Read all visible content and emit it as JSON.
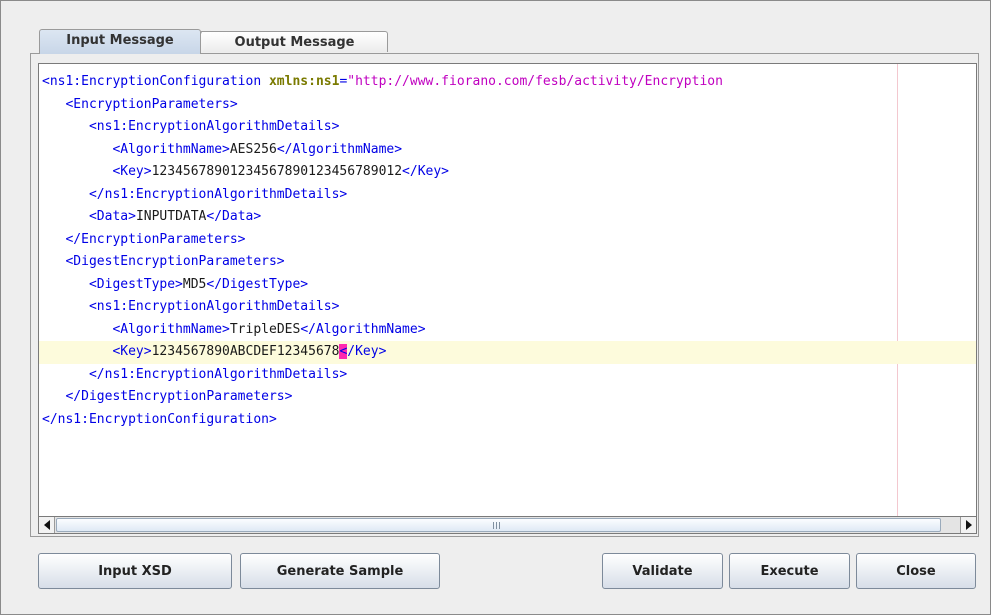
{
  "tabs": [
    {
      "label": "Input Message",
      "selected": true
    },
    {
      "label": "Output Message",
      "selected": false
    }
  ],
  "editor": {
    "lines": [
      {
        "parts": [
          {
            "t": "tag",
            "s": "<ns1:EncryptionConfiguration "
          },
          {
            "t": "attr",
            "s": "xmlns:ns1"
          },
          {
            "t": "tag",
            "s": "="
          },
          {
            "t": "val",
            "s": "\"http://www.fiorano.com/fesb/activity/Encryption"
          }
        ]
      },
      {
        "parts": [
          {
            "t": "text",
            "s": "   "
          },
          {
            "t": "tag",
            "s": "<EncryptionParameters>"
          }
        ]
      },
      {
        "parts": [
          {
            "t": "text",
            "s": "      "
          },
          {
            "t": "tag",
            "s": "<ns1:EncryptionAlgorithmDetails>"
          }
        ]
      },
      {
        "parts": [
          {
            "t": "text",
            "s": "         "
          },
          {
            "t": "tag",
            "s": "<AlgorithmName>"
          },
          {
            "t": "text",
            "s": "AES256"
          },
          {
            "t": "tag",
            "s": "</AlgorithmName>"
          }
        ]
      },
      {
        "parts": [
          {
            "t": "text",
            "s": "         "
          },
          {
            "t": "tag",
            "s": "<Key>"
          },
          {
            "t": "text",
            "s": "12345678901234567890123456789012"
          },
          {
            "t": "tag",
            "s": "</Key>"
          }
        ]
      },
      {
        "parts": [
          {
            "t": "text",
            "s": "      "
          },
          {
            "t": "tag",
            "s": "</ns1:EncryptionAlgorithmDetails>"
          }
        ]
      },
      {
        "parts": [
          {
            "t": "text",
            "s": "      "
          },
          {
            "t": "tag",
            "s": "<Data>"
          },
          {
            "t": "text",
            "s": "INPUTDATA"
          },
          {
            "t": "tag",
            "s": "</Data>"
          }
        ]
      },
      {
        "parts": [
          {
            "t": "text",
            "s": "   "
          },
          {
            "t": "tag",
            "s": "</EncryptionParameters>"
          }
        ]
      },
      {
        "parts": [
          {
            "t": "text",
            "s": "   "
          },
          {
            "t": "tag",
            "s": "<DigestEncryptionParameters>"
          }
        ]
      },
      {
        "parts": [
          {
            "t": "text",
            "s": "      "
          },
          {
            "t": "tag",
            "s": "<DigestType>"
          },
          {
            "t": "text",
            "s": "MD5"
          },
          {
            "t": "tag",
            "s": "</DigestType>"
          }
        ]
      },
      {
        "parts": [
          {
            "t": "text",
            "s": "      "
          },
          {
            "t": "tag",
            "s": "<ns1:EncryptionAlgorithmDetails>"
          }
        ]
      },
      {
        "parts": [
          {
            "t": "text",
            "s": "         "
          },
          {
            "t": "tag",
            "s": "<AlgorithmName>"
          },
          {
            "t": "text",
            "s": "TripleDES"
          },
          {
            "t": "tag",
            "s": "</AlgorithmName>"
          }
        ]
      },
      {
        "current": true,
        "parts": [
          {
            "t": "text",
            "s": "         "
          },
          {
            "t": "tag",
            "s": "<Key>"
          },
          {
            "t": "text",
            "s": "1234567890ABCDEF12345678"
          },
          {
            "t": "caret",
            "s": "<"
          },
          {
            "t": "tag",
            "s": "/Key>"
          }
        ]
      },
      {
        "parts": [
          {
            "t": "text",
            "s": "      "
          },
          {
            "t": "tag",
            "s": "</ns1:EncryptionAlgorithmDetails>"
          }
        ]
      },
      {
        "parts": [
          {
            "t": "text",
            "s": "   "
          },
          {
            "t": "tag",
            "s": "</DigestEncryptionParameters>"
          }
        ]
      },
      {
        "parts": [
          {
            "t": "tag",
            "s": "</ns1:EncryptionConfiguration>"
          }
        ]
      }
    ]
  },
  "buttons": {
    "input_xsd": "Input XSD",
    "generate_sample": "Generate Sample",
    "validate": "Validate",
    "execute": "Execute",
    "close": "Close"
  },
  "colors": {
    "tag": "#0000e6",
    "attribute": "#7a7a00",
    "attribute_value": "#c000c0",
    "caret_highlight": "#ff2ab0",
    "current_line": "#fdfbdc"
  }
}
